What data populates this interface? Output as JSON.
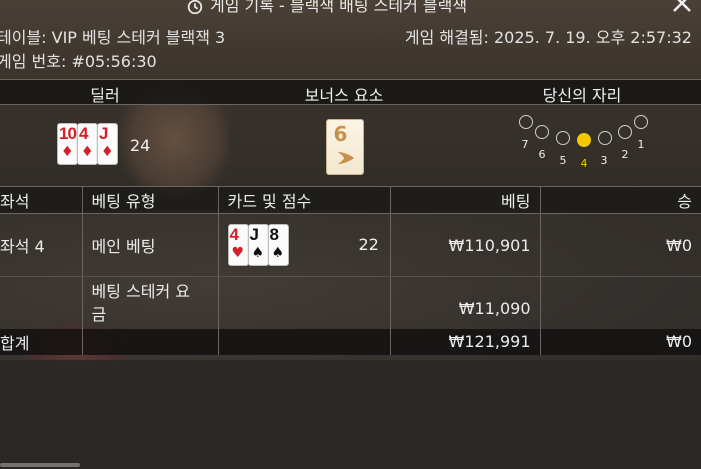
{
  "window": {
    "title": "게임 기록 - 블랙잭 배팅 스테커 블랙잭",
    "history_icon": "history-icon",
    "close_icon": "close-icon"
  },
  "info": {
    "table_label": "테이블: VIP 베팅 스테커 블랙잭 3",
    "game_number_label": "게임 번호: #05:56:30",
    "resolved_label": "게임 해결됨: 2025. 7. 19. 오후 2:57:32"
  },
  "sections": {
    "dealer": "딜러",
    "bonus": "보너스 요소",
    "your_seat": "당신의 자리"
  },
  "dealer": {
    "cards": [
      {
        "rank": "10",
        "suit": "♦",
        "color": "red"
      },
      {
        "rank": "4",
        "suit": "♦",
        "color": "red"
      },
      {
        "rank": "J",
        "suit": "♦",
        "color": "red"
      }
    ],
    "score": "24"
  },
  "bonus": {
    "number": "6",
    "accent_color": "#c8904a"
  },
  "seats": {
    "labels": [
      "7",
      "6",
      "5",
      "4",
      "3",
      "2",
      "1"
    ],
    "selected": "4",
    "selected_color": "#f2c800"
  },
  "table": {
    "columns": [
      "좌석",
      "베팅 유형",
      "카드 및 점수",
      "베팅",
      "승"
    ],
    "rows": [
      {
        "seat": "좌석 4",
        "bet_type": "메인 베팅",
        "cards": [
          {
            "rank": "4",
            "suit": "♥",
            "color": "red"
          },
          {
            "rank": "J",
            "suit": "♠",
            "color": "black"
          },
          {
            "rank": "8",
            "suit": "♠",
            "color": "black"
          }
        ],
        "score": "22",
        "bet": "₩110,901",
        "win": "₩0"
      },
      {
        "seat": "",
        "bet_type_line1": "베팅 스테커 요",
        "bet_type_line2": "금",
        "score": "",
        "bet": "₩11,090",
        "win": ""
      }
    ],
    "total": {
      "label": "합계",
      "bet": "₩121,991",
      "win": "₩0"
    }
  }
}
